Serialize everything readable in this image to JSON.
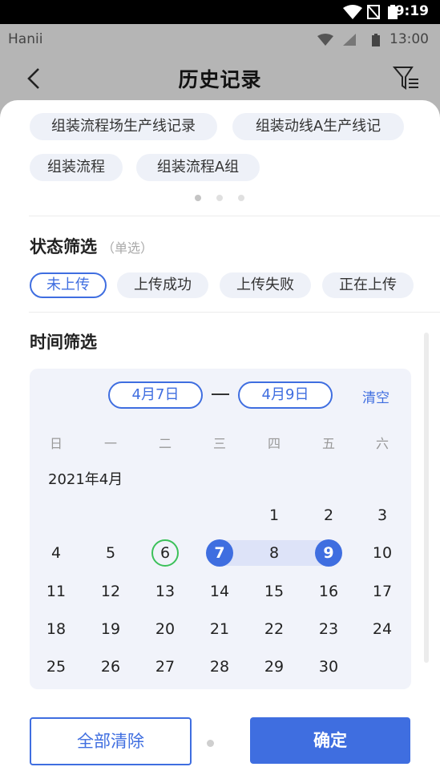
{
  "system_bar": {
    "time": "9:19"
  },
  "app_status": {
    "carrier": "Hanii",
    "time": "13:00"
  },
  "header": {
    "title": "历史记录"
  },
  "lines": [
    {
      "label": "组装流程场生产线记录"
    },
    {
      "label": "组装动线A生产线记"
    },
    {
      "label": "组装流程"
    },
    {
      "label": "组装流程A组"
    }
  ],
  "status_filter": {
    "title": "状态筛选",
    "note": "（单选）",
    "options": [
      {
        "label": "未上传",
        "active": true
      },
      {
        "label": "上传成功",
        "active": false
      },
      {
        "label": "上传失败",
        "active": false
      },
      {
        "label": "正在上传",
        "active": false
      }
    ]
  },
  "time_filter": {
    "title": "时间筛选",
    "start": "4月7日",
    "end": "4月9日",
    "clear": "清空",
    "weekdays": [
      "日",
      "一",
      "二",
      "三",
      "四",
      "五",
      "六"
    ],
    "month_label": "2021年4月",
    "rows": [
      [
        "",
        "",
        "",
        "",
        "1",
        "2",
        "3"
      ],
      [
        "4",
        "5",
        "6",
        "7",
        "8",
        "9",
        "10"
      ],
      [
        "11",
        "12",
        "13",
        "14",
        "15",
        "16",
        "17"
      ],
      [
        "18",
        "19",
        "20",
        "21",
        "22",
        "23",
        "24"
      ],
      [
        "25",
        "26",
        "27",
        "28",
        "29",
        "30",
        ""
      ]
    ],
    "today": "6",
    "range_start": "7",
    "range_end": "9"
  },
  "footer": {
    "clear_all": "全部清除",
    "confirm": "确定"
  },
  "colors": {
    "accent": "#3f6ee0",
    "today_ring": "#3cc15a",
    "range_fill": "#dde3f8"
  }
}
